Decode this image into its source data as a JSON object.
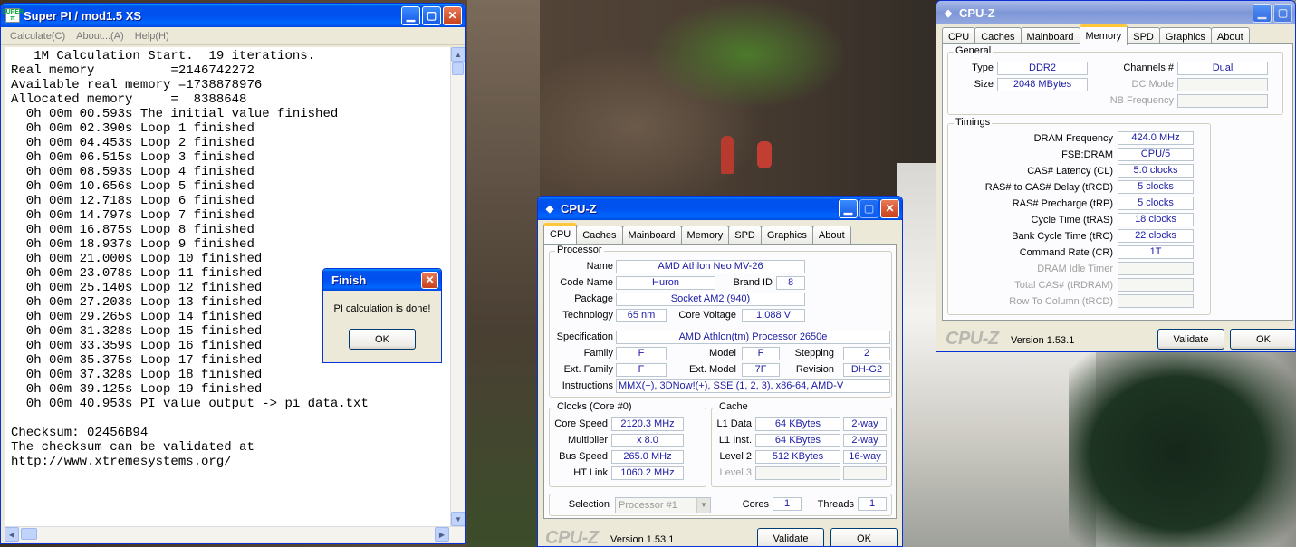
{
  "superpi": {
    "title": "Super PI / mod1.5 XS",
    "menu": [
      "Calculate(C)",
      "About...(A)",
      "Help(H)"
    ],
    "lines": [
      "   1M Calculation Start.  19 iterations.",
      "Real memory          =2146742272",
      "Available real memory =1738878976",
      "Allocated memory     =  8388648",
      "  0h 00m 00.593s The initial value finished",
      "  0h 00m 02.390s Loop 1 finished",
      "  0h 00m 04.453s Loop 2 finished",
      "  0h 00m 06.515s Loop 3 finished",
      "  0h 00m 08.593s Loop 4 finished",
      "  0h 00m 10.656s Loop 5 finished",
      "  0h 00m 12.718s Loop 6 finished",
      "  0h 00m 14.797s Loop 7 finished",
      "  0h 00m 16.875s Loop 8 finished",
      "  0h 00m 18.937s Loop 9 finished",
      "  0h 00m 21.000s Loop 10 finished",
      "  0h 00m 23.078s Loop 11 finished",
      "  0h 00m 25.140s Loop 12 finished",
      "  0h 00m 27.203s Loop 13 finished",
      "  0h 00m 29.265s Loop 14 finished",
      "  0h 00m 31.328s Loop 15 finished",
      "  0h 00m 33.359s Loop 16 finished",
      "  0h 00m 35.375s Loop 17 finished",
      "  0h 00m 37.328s Loop 18 finished",
      "  0h 00m 39.125s Loop 19 finished",
      "  0h 00m 40.953s PI value output -> pi_data.txt",
      "",
      "Checksum: 02456B94",
      "The checksum can be validated at",
      "http://www.xtremesystems.org/"
    ]
  },
  "finish": {
    "title": "Finish",
    "message": "PI calculation is done!",
    "ok": "OK"
  },
  "cpuz_cpu": {
    "title": "CPU-Z",
    "tabs": [
      "CPU",
      "Caches",
      "Mainboard",
      "Memory",
      "SPD",
      "Graphics",
      "About"
    ],
    "processor_group": "Processor",
    "name_label": "Name",
    "name": "AMD Athlon Neo MV-26",
    "codename_label": "Code Name",
    "codename": "Huron",
    "brandid_label": "Brand ID",
    "brandid": "8",
    "package_label": "Package",
    "package": "Socket AM2 (940)",
    "technology_label": "Technology",
    "technology": "65 nm",
    "corevoltage_label": "Core Voltage",
    "corevoltage": "1.088 V",
    "spec_label": "Specification",
    "spec": "AMD Athlon(tm) Processor 2650e",
    "family_label": "Family",
    "family": "F",
    "model_label": "Model",
    "model": "F",
    "stepping_label": "Stepping",
    "stepping": "2",
    "extfamily_label": "Ext. Family",
    "extfamily": "F",
    "extmodel_label": "Ext. Model",
    "extmodel": "7F",
    "revision_label": "Revision",
    "revision": "DH-G2",
    "instr_label": "Instructions",
    "instr": "MMX(+), 3DNow!(+), SSE (1, 2, 3), x86-64, AMD-V",
    "clocks_group": "Clocks (Core #0)",
    "corespeed_label": "Core Speed",
    "corespeed": "2120.3 MHz",
    "multiplier_label": "Multiplier",
    "multiplier": "x 8.0",
    "busspeed_label": "Bus Speed",
    "busspeed": "265.0 MHz",
    "htlink_label": "HT Link",
    "htlink": "1060.2 MHz",
    "cache_group": "Cache",
    "l1d_label": "L1 Data",
    "l1d": "64 KBytes",
    "l1d_way": "2-way",
    "l1i_label": "L1 Inst.",
    "l1i": "64 KBytes",
    "l1i_way": "2-way",
    "l2_label": "Level 2",
    "l2": "512 KBytes",
    "l2_way": "16-way",
    "l3_label": "Level 3",
    "selection_label": "Selection",
    "selection": "Processor #1",
    "cores_label": "Cores",
    "cores": "1",
    "threads_label": "Threads",
    "threads": "1",
    "brand": "CPU-Z",
    "version": "Version 1.53.1",
    "validate": "Validate",
    "ok": "OK"
  },
  "cpuz_mem": {
    "title": "CPU-Z",
    "tabs": [
      "CPU",
      "Caches",
      "Mainboard",
      "Memory",
      "SPD",
      "Graphics",
      "About"
    ],
    "general_group": "General",
    "type_label": "Type",
    "type": "DDR2",
    "size_label": "Size",
    "size": "2048 MBytes",
    "channels_label": "Channels #",
    "channels": "Dual",
    "dcmode_label": "DC Mode",
    "nbfreq_label": "NB Frequency",
    "timings_group": "Timings",
    "dramfreq_label": "DRAM Frequency",
    "dramfreq": "424.0 MHz",
    "fsbdram_label": "FSB:DRAM",
    "fsbdram": "CPU/5",
    "cas_label": "CAS# Latency (CL)",
    "cas": "5.0 clocks",
    "trcd_label": "RAS# to CAS# Delay (tRCD)",
    "trcd": "5 clocks",
    "trp_label": "RAS# Precharge (tRP)",
    "trp": "5 clocks",
    "tras_label": "Cycle Time (tRAS)",
    "tras": "18 clocks",
    "trc_label": "Bank Cycle Time (tRC)",
    "trc": "22 clocks",
    "cr_label": "Command Rate (CR)",
    "cr": "1T",
    "idle_label": "DRAM Idle Timer",
    "trdram_label": "Total CAS# (tRDRAM)",
    "rtc_label": "Row To Column (tRCD)",
    "brand": "CPU-Z",
    "version": "Version 1.53.1",
    "validate": "Validate",
    "ok": "OK"
  }
}
